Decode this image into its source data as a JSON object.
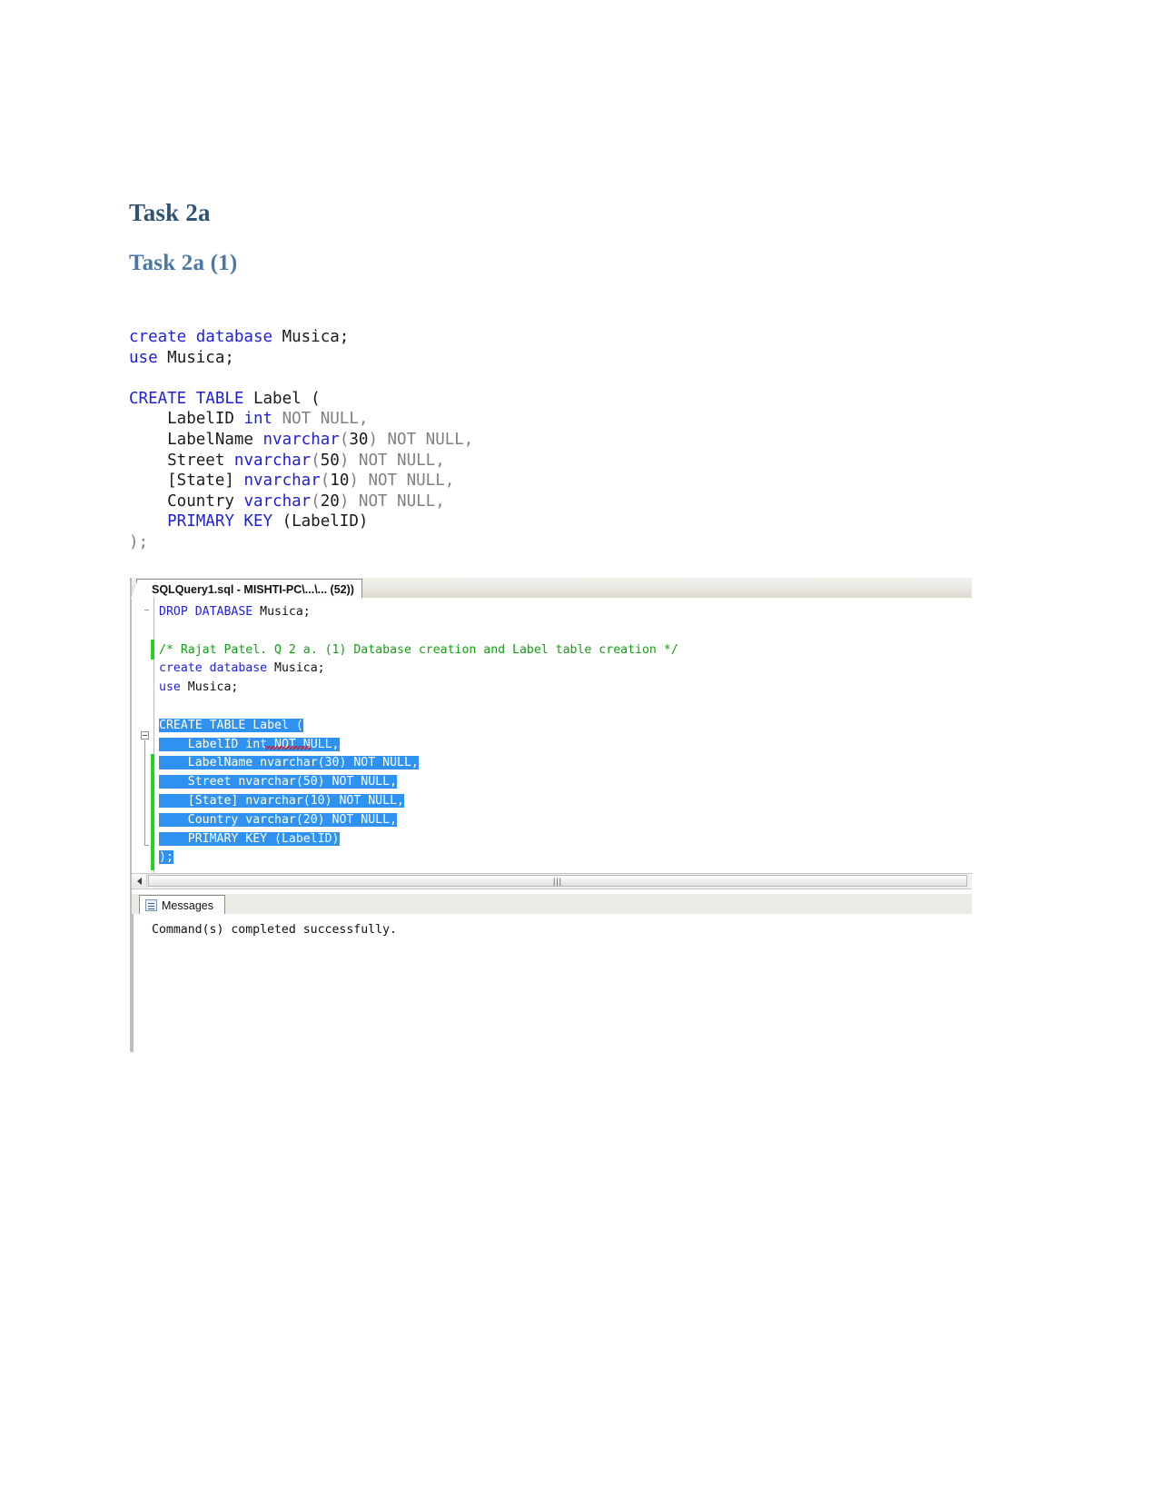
{
  "document": {
    "heading1": "Task 2a",
    "heading2": "Task 2a (1)"
  },
  "doc_code": {
    "lines": [
      {
        "segments": [
          {
            "text": "create database ",
            "style": "kw"
          },
          {
            "text": "Musica;",
            "style": "pl"
          }
        ]
      },
      {
        "segments": [
          {
            "text": "use ",
            "style": "kw"
          },
          {
            "text": "Musica;",
            "style": "pl"
          }
        ]
      },
      {
        "segments": []
      },
      {
        "segments": [
          {
            "text": "CREATE TABLE ",
            "style": "kw"
          },
          {
            "text": "Label (",
            "style": "pl"
          }
        ]
      },
      {
        "segments": [
          {
            "text": "    LabelID ",
            "style": "pl"
          },
          {
            "text": "int",
            "style": "ty"
          },
          {
            "text": " NOT NULL,",
            "style": "dim"
          }
        ]
      },
      {
        "segments": [
          {
            "text": "    LabelName ",
            "style": "pl"
          },
          {
            "text": "nvarchar",
            "style": "ty"
          },
          {
            "text": "(",
            "style": "dim"
          },
          {
            "text": "30",
            "style": "num"
          },
          {
            "text": ")",
            "style": "dim"
          },
          {
            "text": " NOT NULL,",
            "style": "dim"
          }
        ]
      },
      {
        "segments": [
          {
            "text": "    Street ",
            "style": "pl"
          },
          {
            "text": "nvarchar",
            "style": "ty"
          },
          {
            "text": "(",
            "style": "dim"
          },
          {
            "text": "50",
            "style": "num"
          },
          {
            "text": ")",
            "style": "dim"
          },
          {
            "text": " NOT NULL,",
            "style": "dim"
          }
        ]
      },
      {
        "segments": [
          {
            "text": "    [State] ",
            "style": "pl"
          },
          {
            "text": "nvarchar",
            "style": "ty"
          },
          {
            "text": "(",
            "style": "dim"
          },
          {
            "text": "10",
            "style": "num"
          },
          {
            "text": ")",
            "style": "dim"
          },
          {
            "text": " NOT NULL,",
            "style": "dim"
          }
        ]
      },
      {
        "segments": [
          {
            "text": "    Country ",
            "style": "pl"
          },
          {
            "text": "varchar",
            "style": "ty"
          },
          {
            "text": "(",
            "style": "dim"
          },
          {
            "text": "20",
            "style": "num"
          },
          {
            "text": ")",
            "style": "dim"
          },
          {
            "text": " NOT NULL,",
            "style": "dim"
          }
        ]
      },
      {
        "segments": [
          {
            "text": "    PRIMARY KEY ",
            "style": "kw"
          },
          {
            "text": "(LabelID)",
            "style": "pl"
          }
        ]
      },
      {
        "segments": [
          {
            "text": ");",
            "style": "dim"
          }
        ]
      }
    ]
  },
  "screenshot": {
    "tab_title": "SQLQuery1.sql - MISHTI-PC\\...\\... (52))",
    "editor_lines": [
      {
        "segments": [
          {
            "text": "DROP DATABASE ",
            "style": "kw"
          },
          {
            "text": "Musica;",
            "style": "pl"
          }
        ]
      },
      {
        "segments": []
      },
      {
        "segments": [
          {
            "text": "/* Rajat Patel. Q 2 a. (1) Database creation and Label table creation */",
            "style": "cm"
          }
        ]
      },
      {
        "segments": [
          {
            "text": "create database ",
            "style": "kw"
          },
          {
            "text": "Musica;",
            "style": "pl"
          }
        ]
      },
      {
        "segments": [
          {
            "text": "use ",
            "style": "kw"
          },
          {
            "text": "Musica;",
            "style": "pl"
          }
        ]
      },
      {
        "segments": []
      },
      {
        "segments": [
          {
            "text": "CREATE TABLE Label (",
            "style": "sel"
          }
        ]
      },
      {
        "segments": [
          {
            "text": "    LabelID int NOT NULL,",
            "style": "sel"
          }
        ]
      },
      {
        "segments": [
          {
            "text": "    LabelName nvarchar(30) NOT NULL,",
            "style": "sel"
          }
        ]
      },
      {
        "segments": [
          {
            "text": "    Street nvarchar(50) NOT NULL,",
            "style": "sel"
          }
        ]
      },
      {
        "segments": [
          {
            "text": "    [State] nvarchar(10) NOT NULL,",
            "style": "sel"
          }
        ]
      },
      {
        "segments": [
          {
            "text": "    Country varchar(20) NOT NULL,",
            "style": "sel"
          }
        ]
      },
      {
        "segments": [
          {
            "text": "    PRIMARY KEY (LabelID)",
            "style": "sel"
          }
        ]
      },
      {
        "segments": [
          {
            "text": ");",
            "style": "sel"
          }
        ]
      }
    ],
    "scrollbar": {
      "grip": "|||"
    },
    "messages_tab_label": "Messages",
    "messages_text": "Command(s) completed successfully."
  },
  "colors": {
    "heading1": "#2f5476",
    "heading2": "#4a77a8",
    "keyword": "#1f1fd8",
    "comment": "#12a012",
    "selection": "#2f92f0",
    "changebar": "#22d422"
  }
}
